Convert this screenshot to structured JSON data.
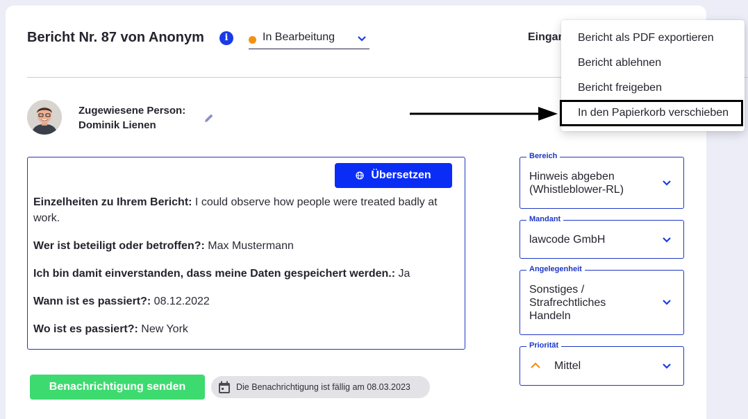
{
  "header": {
    "title": "Bericht Nr. 87 von Anonym",
    "status": "In Bearbeitung",
    "status_color": "#f39113",
    "eingang_label": "Eingan"
  },
  "assignee": {
    "label": "Zugewiesene Person:",
    "name": "Dominik Lienen"
  },
  "report": {
    "translate_label": "Übersetzen",
    "fields": [
      {
        "label": "Einzelheiten zu Ihrem Bericht:",
        "value": " I could observe how people were treated badly at work."
      },
      {
        "label": "Wer ist beteiligt oder betroffen?:",
        "value": " Max Mustermann"
      },
      {
        "label": "Ich bin damit einverstanden, dass meine Daten gespeichert werden.:",
        "value": " Ja"
      },
      {
        "label": "Wann ist es passiert?:",
        "value": " 08.12.2022"
      },
      {
        "label": "Wo ist es passiert?:",
        "value": " New York"
      }
    ]
  },
  "actions": {
    "send_label": "Benachrichtigung senden",
    "due_text": "Die Benachrichtigung ist fällig am 08.03.2023",
    "send_color": "#3ddb6f"
  },
  "selects": {
    "bereich": {
      "label": "Bereich",
      "value": "Hinweis abgeben\n(Whistleblower-RL)"
    },
    "mandant": {
      "label": "Mandant",
      "value": "lawcode GmbH"
    },
    "angelegenheit": {
      "label": "Angelegenheit",
      "value": "Sonstiges /\nStrafrechtliches\nHandeln"
    },
    "prioritaet": {
      "label": "Priorität",
      "value": "Mittel",
      "icon": "chevron-up-icon",
      "icon_color": "#f39113"
    }
  },
  "menu": {
    "items": [
      "Bericht als PDF exportieren",
      "Bericht ablehnen",
      "Bericht freigeben",
      "In den Papierkorb verschieben"
    ],
    "highlighted": "In den Papierkorb verschieben"
  },
  "colors": {
    "primary": "#0a2df5",
    "border": "#1d37c5",
    "background": "#ecedf7"
  }
}
